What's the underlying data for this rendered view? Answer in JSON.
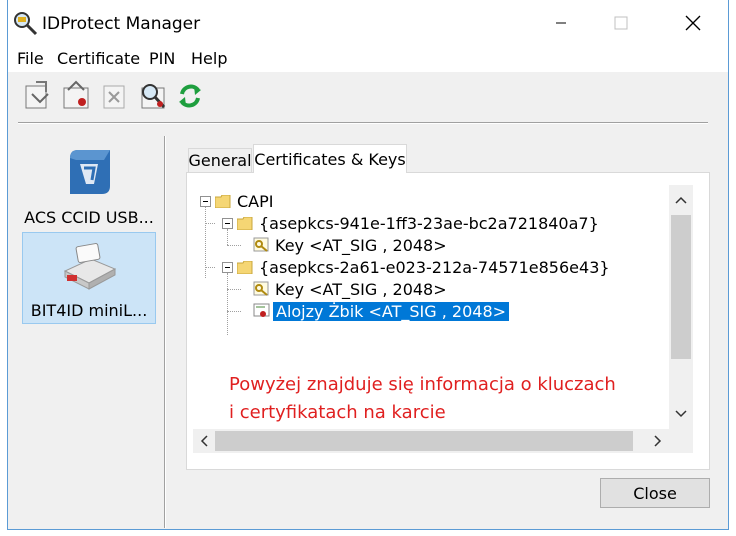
{
  "window": {
    "title": "IDProtect Manager",
    "controls": {
      "minimize": "minimize",
      "maximize": "maximize",
      "close": "close"
    }
  },
  "menu": [
    "File",
    "Certificate",
    "PIN",
    "Help"
  ],
  "toolbar": {
    "buttons": [
      "import-icon",
      "export-icon",
      "delete-icon",
      "view-certificate-icon",
      "refresh-icon"
    ]
  },
  "readers": [
    {
      "label": "ACS CCID USB...",
      "selected": false
    },
    {
      "label": "BIT4ID miniL...",
      "selected": true
    }
  ],
  "tabs": [
    {
      "label": "General",
      "active": false
    },
    {
      "label": "Certificates & Keys",
      "active": true
    }
  ],
  "tree": {
    "root": "CAPI",
    "containers": [
      {
        "name": "{asepkcs-941e-1ff3-23ae-bc2a721840a7}",
        "items": [
          {
            "label": "Key  <AT_SIG , 2048>",
            "type": "key"
          }
        ]
      },
      {
        "name": "{asepkcs-2a61-e023-212a-74571e856e43}",
        "items": [
          {
            "label": "Key  <AT_SIG , 2048>",
            "type": "key"
          },
          {
            "label": "Alojzy Żbik <AT_SIG , 2048>",
            "type": "certificate",
            "selected": true
          }
        ]
      }
    ]
  },
  "annotation": {
    "line1": "Powyżej znajduje się informacja o kluczach",
    "line2": "i certyfikatach na karcie",
    "color": "#e02020"
  },
  "buttons": {
    "close": "Close"
  },
  "colors": {
    "selection": "#0078d7",
    "reader_selected_bg": "#cce4f7"
  }
}
